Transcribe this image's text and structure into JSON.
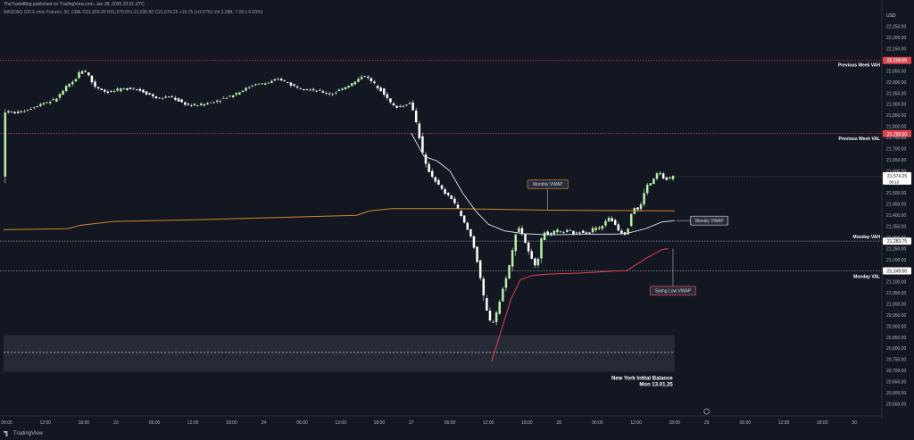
{
  "header": {
    "publisher": "TheTradeBlog published on TradingView.com, Jan 28, 2025 23:21 UTC",
    "symbol_line": "NASDAQ 100 E-mini Futures, 30, CME O21,559.00 H21,579.00 L21,530.50 C21,574.25 +15.75 (+0.07%) Vol 2.08K -7.50 (-0.03%)"
  },
  "footer": {
    "brand": "TradingView"
  },
  "colors": {
    "background": "#131722",
    "up": "#b6f2a4",
    "down": "#ffffff",
    "wick": "#e0e3eb",
    "monthly_vwap": "#d4872a",
    "weekly_vwap": "#d1d4dc",
    "swing_low_vwap": "#e0434f",
    "week_level": "#e0434f",
    "monday_level": "#9598a1",
    "ib_box": "#2a2e39"
  },
  "chart_data": {
    "type": "candlestick",
    "currency": "USD",
    "yaxis_ticks": [
      22250,
      22200,
      22150,
      22100,
      22050,
      22000,
      21950,
      21900,
      21850,
      21800,
      21750,
      21700,
      21650,
      21600,
      21550,
      21500,
      21450,
      21400,
      21350,
      21300,
      21250,
      21200,
      21150,
      21100,
      21050,
      21000,
      20950,
      20900,
      20850,
      20800,
      20750,
      20700,
      20650,
      20600,
      20550
    ],
    "xaxis_ticks": [
      {
        "label": "06:00",
        "slot": 1
      },
      {
        "label": "12:00",
        "slot": 13
      },
      {
        "label": "18:00",
        "slot": 25
      },
      {
        "label": "23",
        "slot": 35
      },
      {
        "label": "06:00",
        "slot": 47
      },
      {
        "label": "12:00",
        "slot": 59
      },
      {
        "label": "18:00",
        "slot": 71
      },
      {
        "label": "24",
        "slot": 81
      },
      {
        "label": "06:00",
        "slot": 93
      },
      {
        "label": "12:00",
        "slot": 105
      },
      {
        "label": "18:00",
        "slot": 117
      },
      {
        "label": "27",
        "slot": 127
      },
      {
        "label": "06:00",
        "slot": 139
      },
      {
        "label": "12:00",
        "slot": 151
      },
      {
        "label": "18:00",
        "slot": 163
      },
      {
        "label": "28",
        "slot": 173
      },
      {
        "label": "06:00",
        "slot": 185
      },
      {
        "label": "12:00",
        "slot": 197
      },
      {
        "label": "18:00",
        "slot": 209
      },
      {
        "label": "29",
        "slot": 219
      },
      {
        "label": "06:00",
        "slot": 231
      },
      {
        "label": "12:00",
        "slot": 243
      },
      {
        "label": "18:00",
        "slot": 255
      },
      {
        "label": "30",
        "slot": 265
      }
    ],
    "price_path": [
      [
        0,
        21868
      ],
      [
        4,
        21862
      ],
      [
        8,
        21880
      ],
      [
        12,
        21905
      ],
      [
        16,
        21920
      ],
      [
        20,
        21985
      ],
      [
        22,
        22005
      ],
      [
        24,
        22055
      ],
      [
        26,
        22045
      ],
      [
        28,
        21985
      ],
      [
        32,
        21955
      ],
      [
        36,
        21965
      ],
      [
        40,
        21975
      ],
      [
        44,
        21955
      ],
      [
        48,
        21925
      ],
      [
        52,
        21935
      ],
      [
        56,
        21905
      ],
      [
        58,
        21895
      ],
      [
        62,
        21900
      ],
      [
        66,
        21915
      ],
      [
        70,
        21935
      ],
      [
        74,
        21960
      ],
      [
        78,
        21990
      ],
      [
        82,
        21995
      ],
      [
        86,
        22015
      ],
      [
        90,
        21985
      ],
      [
        94,
        21970
      ],
      [
        98,
        21960
      ],
      [
        102,
        21945
      ],
      [
        106,
        21975
      ],
      [
        110,
        22005
      ],
      [
        112,
        22035
      ],
      [
        114,
        22010
      ],
      [
        118,
        21960
      ],
      [
        120,
        21915
      ],
      [
        122,
        21885
      ],
      [
        124,
        21895
      ],
      [
        126,
        21905
      ],
      [
        127,
        21905
      ],
      [
        129,
        21790
      ],
      [
        131,
        21640
      ],
      [
        133,
        21585
      ],
      [
        135,
        21545
      ],
      [
        137,
        21505
      ],
      [
        140,
        21470
      ],
      [
        143,
        21380
      ],
      [
        146,
        21290
      ],
      [
        148,
        21160
      ],
      [
        150,
        20990
      ],
      [
        152,
        20900
      ],
      [
        154,
        20985
      ],
      [
        156,
        21095
      ],
      [
        158,
        21200
      ],
      [
        160,
        21360
      ],
      [
        162,
        21300
      ],
      [
        164,
        21210
      ],
      [
        166,
        21170
      ],
      [
        168,
        21330
      ],
      [
        170,
        21310
      ],
      [
        172,
        21330
      ],
      [
        174,
        21325
      ],
      [
        176,
        21330
      ],
      [
        178,
        21315
      ],
      [
        180,
        21330
      ],
      [
        182,
        21320
      ],
      [
        184,
        21345
      ],
      [
        186,
        21340
      ],
      [
        188,
        21390
      ],
      [
        190,
        21370
      ],
      [
        192,
        21325
      ],
      [
        194,
        21315
      ],
      [
        196,
        21440
      ],
      [
        198,
        21420
      ],
      [
        200,
        21530
      ],
      [
        202,
        21550
      ],
      [
        204,
        21600
      ],
      [
        206,
        21555
      ],
      [
        208,
        21574.25
      ]
    ],
    "series": [
      {
        "name": "Monthly VWAP",
        "points": [
          [
            0,
            21335
          ],
          [
            20,
            21340
          ],
          [
            24,
            21355
          ],
          [
            34,
            21372
          ],
          [
            60,
            21380
          ],
          [
            110,
            21400
          ],
          [
            114,
            21420
          ],
          [
            121,
            21430
          ],
          [
            140,
            21430
          ],
          [
            170,
            21423
          ],
          [
            209,
            21420
          ]
        ]
      },
      {
        "name": "Weekly VWAP",
        "points": [
          [
            127,
            21770
          ],
          [
            131,
            21665
          ],
          [
            135,
            21645
          ],
          [
            139,
            21600
          ],
          [
            143,
            21500
          ],
          [
            147,
            21420
          ],
          [
            151,
            21360
          ],
          [
            156,
            21330
          ],
          [
            162,
            21317
          ],
          [
            170,
            21312
          ],
          [
            180,
            21315
          ],
          [
            190,
            21315
          ],
          [
            194,
            21318
          ],
          [
            200,
            21340
          ],
          [
            205,
            21370
          ],
          [
            209,
            21376
          ]
        ]
      },
      {
        "name": "Swing Low VWAP",
        "points": [
          [
            152,
            20740
          ],
          [
            155,
            20880
          ],
          [
            158,
            21020
          ],
          [
            161,
            21110
          ],
          [
            165,
            21130
          ],
          [
            170,
            21135
          ],
          [
            180,
            21140
          ],
          [
            192,
            21150
          ],
          [
            194,
            21150
          ],
          [
            200,
            21205
          ],
          [
            205,
            21245
          ],
          [
            207,
            21250
          ]
        ]
      }
    ],
    "levels": [
      {
        "label": "Previous Week VAH",
        "value": 22098.0,
        "badge": "22,098.00",
        "style": "dotted-red"
      },
      {
        "label": "Previous Week VAL",
        "value": 21768.0,
        "badge": "21,768.00",
        "style": "dotted-red"
      },
      {
        "label": "Monday VAH",
        "value": 21283.75,
        "badge": "21,283.75",
        "style": "dotted-grey"
      },
      {
        "label": "Monday VAL",
        "value": 21149.5,
        "badge": "21,149.50",
        "style": "dotted-grey"
      }
    ],
    "last_price": {
      "value": 21574.25,
      "label": "21,574.25",
      "countdown": "08:10"
    },
    "initial_balance": {
      "title": "New York Initial Balance",
      "date": "Mon 13.01.25",
      "high": 20860,
      "low": 20695,
      "mid": 20782,
      "from_slot": 0,
      "to_slot": 209
    },
    "callouts": [
      {
        "label": "Monthly VWAP",
        "anchor_slot": 169,
        "anchor_value": 21425,
        "box_value": 21540
      },
      {
        "label": "Weekly VWAP",
        "anchor_slot": 209,
        "anchor_value": 21376,
        "box_value": 21376
      },
      {
        "label": "Swing Low VWAP",
        "anchor_slot": 208,
        "anchor_value": 21250,
        "box_value": 21060
      }
    ],
    "ylim": [
      20520,
      22290
    ],
    "xlim": [
      0,
      268
    ]
  }
}
